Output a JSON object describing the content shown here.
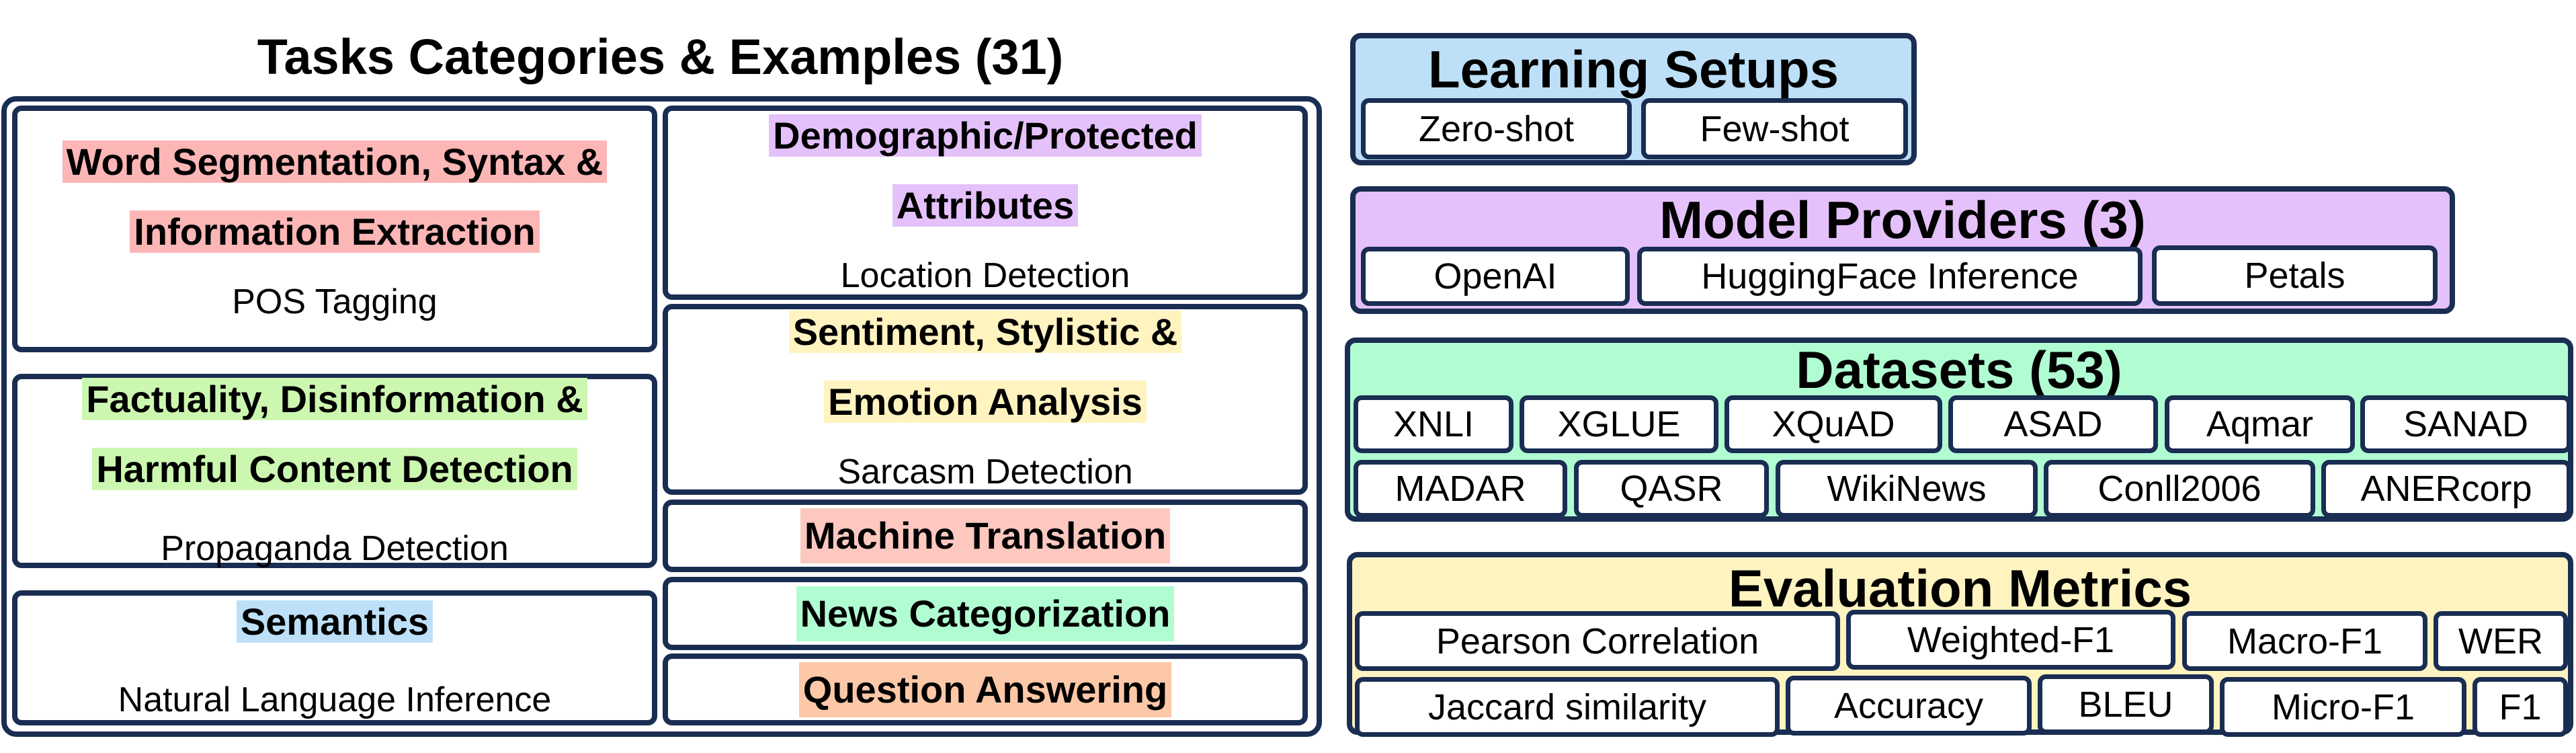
{
  "colors": {
    "border": "#1a2d52",
    "pink": "#fcb6b6",
    "purple": "#e5c1fb",
    "green": "#ccf7b0",
    "yellow": "#fff3c0",
    "salmon": "#fdc8c0",
    "mint": "#b0fdd2",
    "peach": "#fdc8a8",
    "blue": "#bde0f8"
  },
  "tasks": {
    "title": "Tasks Categories & Examples (31)",
    "left": [
      {
        "category_lines": [
          "Word Segmentation, Syntax &",
          "Information Extraction"
        ],
        "example": "POS Tagging"
      },
      {
        "category_lines": [
          "Factuality, Disinformation &",
          "Harmful Content Detection"
        ],
        "example": "Propaganda Detection"
      },
      {
        "category_lines": [
          "Semantics"
        ],
        "example": "Natural Language Inference"
      }
    ],
    "right": [
      {
        "category_lines": [
          "Demographic/Protected",
          "Attributes"
        ],
        "example": "Location Detection"
      },
      {
        "category_lines": [
          "Sentiment, Stylistic &",
          "Emotion Analysis"
        ],
        "example": "Sarcasm Detection"
      },
      {
        "category_lines": [
          "Machine Translation"
        ]
      },
      {
        "category_lines": [
          "News Categorization"
        ]
      },
      {
        "category_lines": [
          "Question Answering"
        ]
      }
    ]
  },
  "learning_setups": {
    "title": "Learning Setups",
    "items": [
      "Zero-shot",
      "Few-shot"
    ]
  },
  "model_providers": {
    "title": "Model Providers (3)",
    "items": [
      "OpenAI",
      "HuggingFace Inference",
      "Petals"
    ]
  },
  "datasets": {
    "title": "Datasets (53)",
    "row1": [
      "XNLI",
      "XGLUE",
      "XQuAD",
      "ASAD",
      "Aqmar",
      "SANAD"
    ],
    "row2": [
      "MADAR",
      "QASR",
      "WikiNews",
      "Conll2006",
      "ANERcorp"
    ]
  },
  "evaluation_metrics": {
    "title": "Evaluation Metrics",
    "row1": [
      "Pearson Correlation",
      "Weighted-F1",
      "Macro-F1",
      "WER"
    ],
    "row2": [
      "Jaccard similarity",
      "Accuracy",
      "BLEU",
      "Micro-F1",
      "F1"
    ]
  }
}
